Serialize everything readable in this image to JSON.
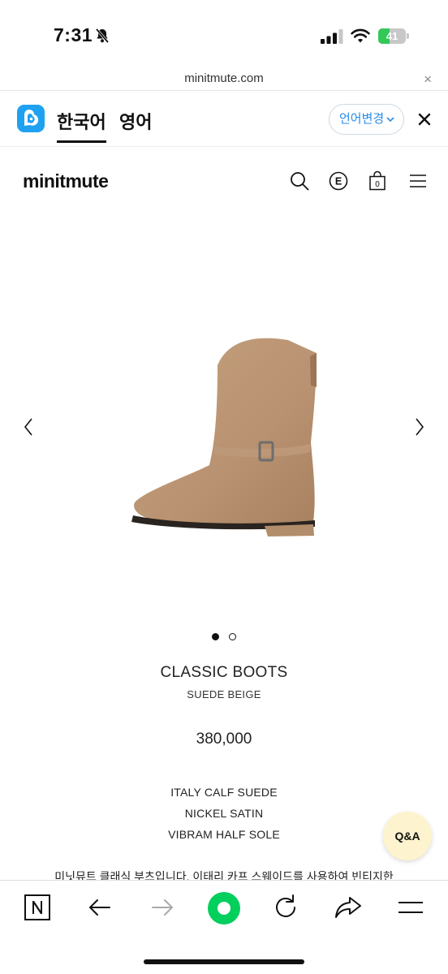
{
  "status_bar": {
    "time": "7:31",
    "battery_level": "41",
    "battery_fraction": 0.41,
    "icons": [
      "bell-slash-icon",
      "signal-icon",
      "wifi-icon",
      "battery-icon"
    ]
  },
  "url_bar": {
    "url": "minitmute.com",
    "close_label": "×"
  },
  "translate_bar": {
    "tabs": [
      {
        "label": "한국어",
        "active": true
      },
      {
        "label": "영어",
        "active": false
      }
    ],
    "change_language_label": "언어변경",
    "accent_color": "#2a8ce8",
    "logo_color": "#1fa1f1"
  },
  "site_header": {
    "logo": "minitmute",
    "icons": [
      "search-icon",
      "e-icon",
      "bag-icon",
      "menu-icon"
    ],
    "cart_count": "0"
  },
  "product": {
    "image_indicator": {
      "total": 2,
      "active": 1
    },
    "title": "CLASSIC BOOTS",
    "color": "SUEDE BEIGE",
    "price": "380,000",
    "specs": [
      "ITALY CALF SUEDE",
      "NICKEL SATIN",
      "VIBRAM HALF SOLE"
    ],
    "description": "미닛뮤트 클래식 부츠입니다. 이태리 카프 스웨이드를 사용하여 빈티지한"
  },
  "qa_button": {
    "label": "Q&A",
    "color": "#fdf3cf"
  },
  "browser_toolbar": {
    "icons": [
      "n-home-icon",
      "back-arrow-icon",
      "forward-arrow-icon",
      "green-dot-icon",
      "reload-icon",
      "share-icon",
      "menu-lines-icon"
    ],
    "green_color": "#03cf5d"
  }
}
